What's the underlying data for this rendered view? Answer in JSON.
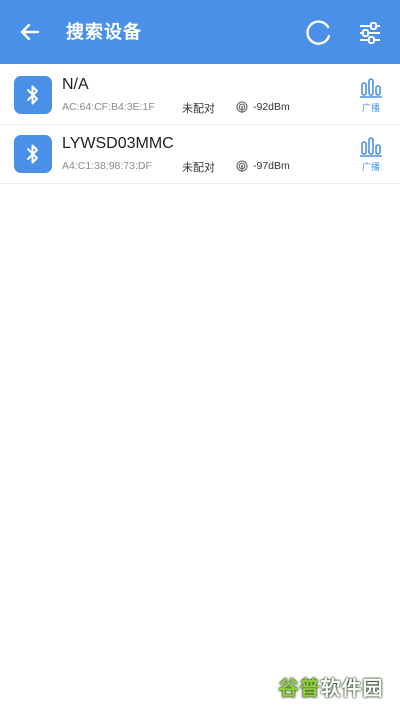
{
  "header": {
    "title": "搜索设备",
    "back_icon": "arrow-left-icon",
    "refresh_icon": "refresh-icon",
    "filter_icon": "filter-sliders-icon",
    "background_color": "#4a90e8"
  },
  "devices": [
    {
      "name": "N/A",
      "mac": "AC:64:CF:B4:3E:1F",
      "status": "未配对",
      "rssi": "-92dBm",
      "icon": "bluetooth-icon",
      "action_label": "广播"
    },
    {
      "name": "LYWSD03MMC",
      "mac": "A4:C1:38:98:73:DF",
      "status": "未配对",
      "rssi": "-97dBm",
      "icon": "bluetooth-icon",
      "action_label": "广播"
    }
  ],
  "watermark": {
    "brand": "谷普",
    "suffix": "软件园"
  },
  "colors": {
    "accent": "#4a90e8",
    "text_primary": "#222222",
    "text_secondary": "#8a8a8a"
  }
}
